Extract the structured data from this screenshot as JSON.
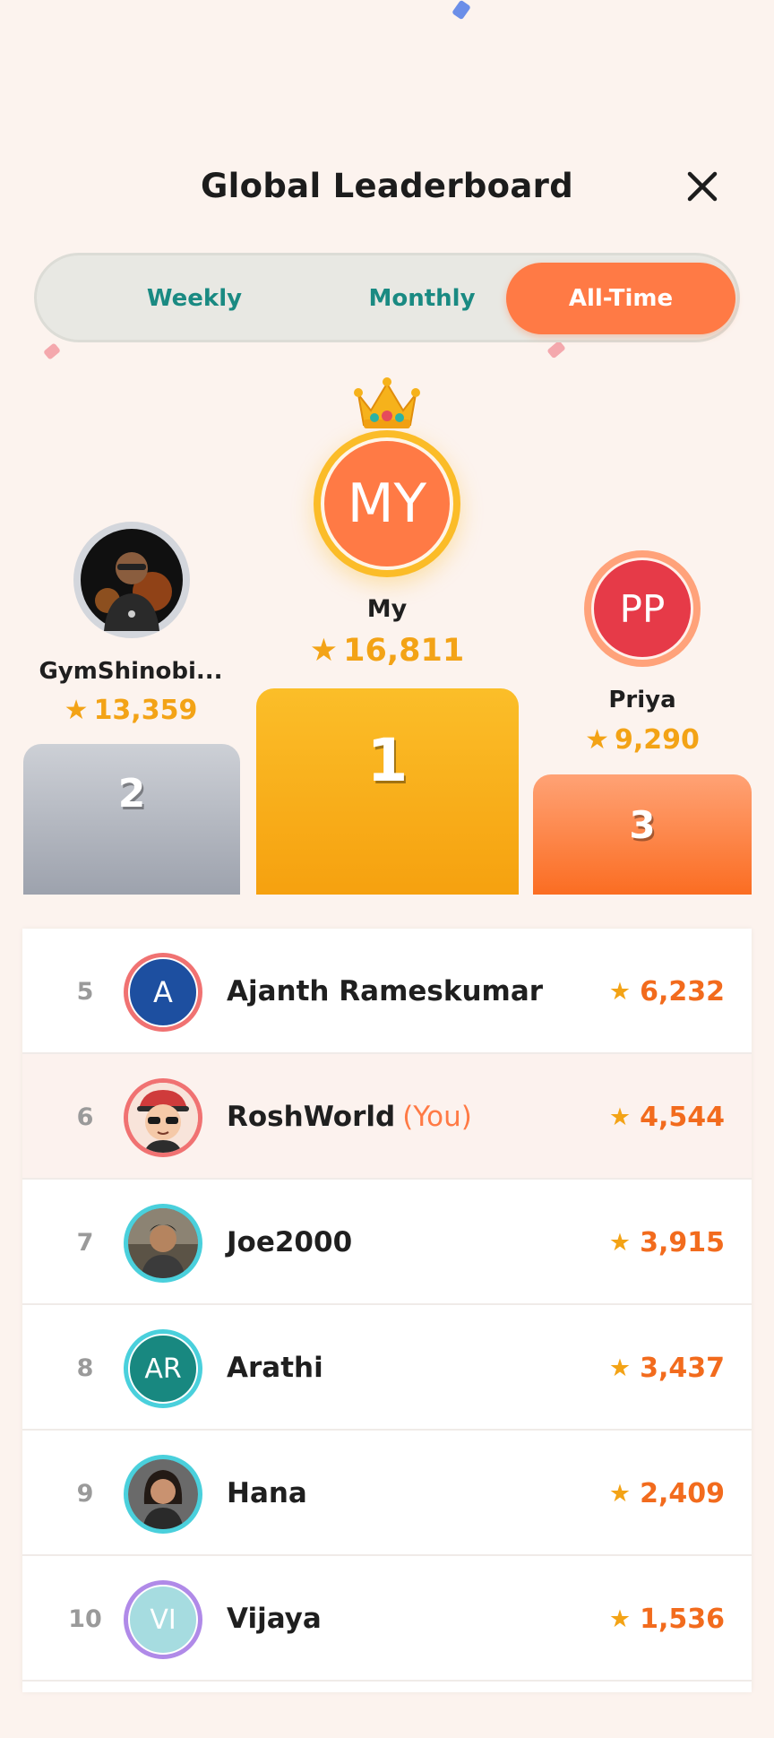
{
  "header": {
    "title": "Global Leaderboard"
  },
  "tabs": [
    {
      "label": "Weekly",
      "active": false
    },
    {
      "label": "Monthly",
      "active": false
    },
    {
      "label": "All-Time",
      "active": true
    }
  ],
  "podium": {
    "first": {
      "rank": "1",
      "name": "My",
      "initials": "MY",
      "score": "16,811",
      "color": "#ff7a45",
      "ring": "#fbbc28"
    },
    "second": {
      "rank": "2",
      "name": "GymShinobi...",
      "score": "13,359",
      "avatar": "photo",
      "ring": "#d3d6dc"
    },
    "third": {
      "rank": "3",
      "name": "Priya",
      "initials": "PP",
      "score": "9,290",
      "color": "#e63a48",
      "ring": "#ffa27a"
    }
  },
  "list": [
    {
      "rank": "5",
      "name": "Ajanth Rameskumar",
      "initials": "A",
      "score": "6,232",
      "color": "#1d4fa0",
      "ring": "#f07272"
    },
    {
      "rank": "6",
      "name": "RoshWorld",
      "you": "(You)",
      "score": "4,544",
      "avatar": "cartoon",
      "ring": "#f07272",
      "me": true
    },
    {
      "rank": "7",
      "name": "Joe2000",
      "score": "3,915",
      "avatar": "photo",
      "ring": "#4ad0dc"
    },
    {
      "rank": "8",
      "name": "Arathi",
      "initials": "AR",
      "score": "3,437",
      "color": "#188880",
      "ring": "#4ad0dc"
    },
    {
      "rank": "9",
      "name": "Hana",
      "score": "2,409",
      "avatar": "photo",
      "ring": "#4ad0dc"
    },
    {
      "rank": "10",
      "name": "Vijaya",
      "initials": "VI",
      "score": "1,536",
      "color": "#a6dce0",
      "ring": "#b08ae8"
    }
  ],
  "colors": {
    "accent": "#ff7a45",
    "gold": "#f3a316",
    "teal": "#1a8a82",
    "background": "#fcf3ee"
  },
  "icons": {
    "close": "close-icon",
    "crown": "crown-icon",
    "star": "star-icon"
  }
}
